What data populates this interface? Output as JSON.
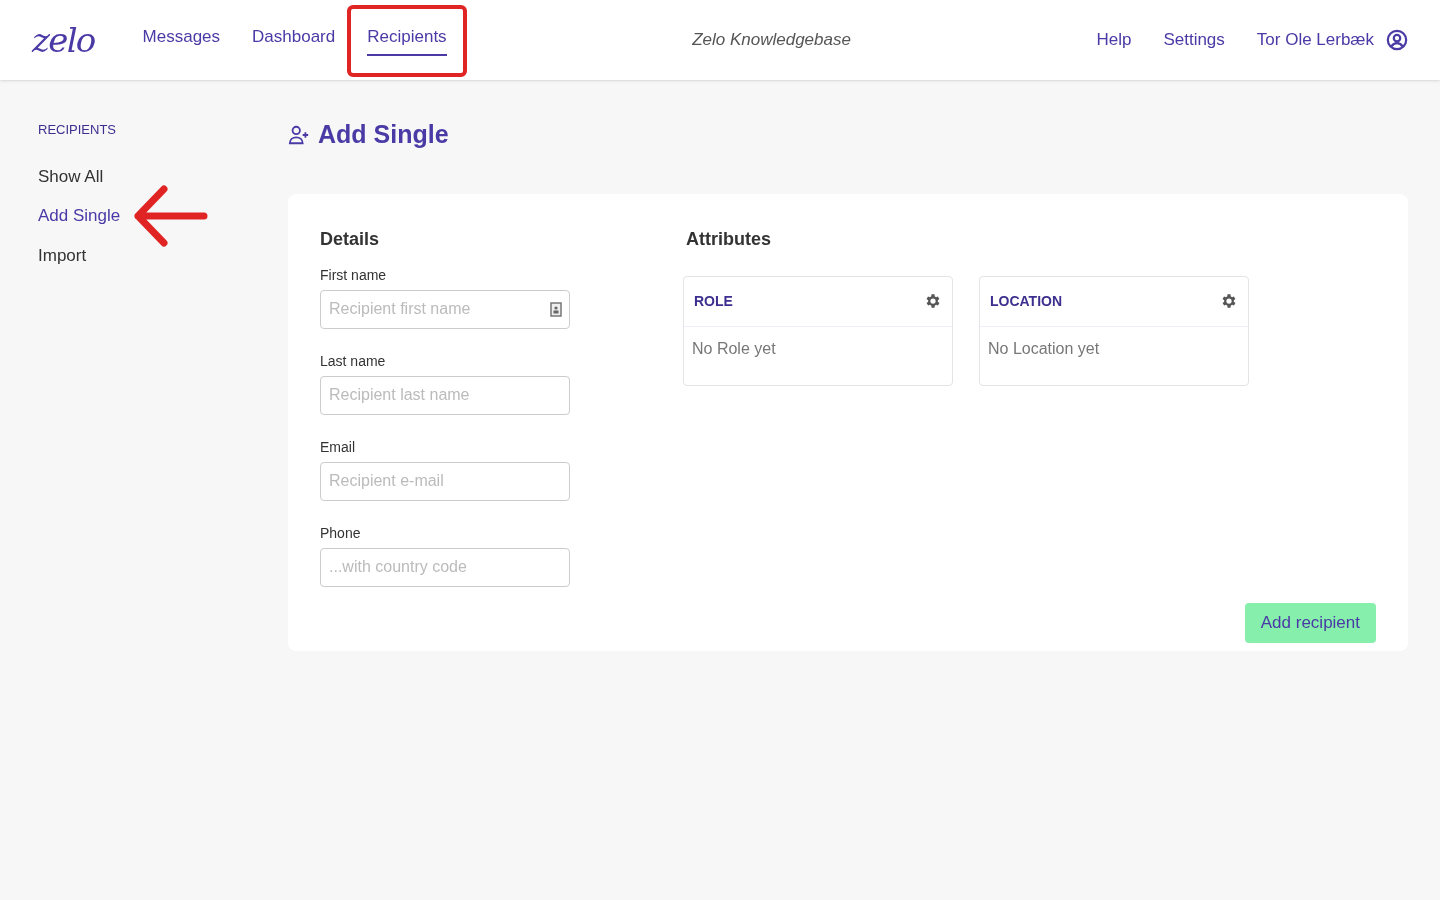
{
  "header": {
    "logo": "zelo",
    "nav": [
      {
        "label": "Messages",
        "selected": false
      },
      {
        "label": "Dashboard",
        "selected": false
      },
      {
        "label": "Recipients",
        "selected": true,
        "highlighted": true
      }
    ],
    "center_link": "Zelo Knowledgebase",
    "right": [
      {
        "label": "Help"
      },
      {
        "label": "Settings"
      }
    ],
    "user": "Tor Ole Lerbæk"
  },
  "sidebar": {
    "heading": "RECIPIENTS",
    "items": [
      {
        "label": "Show All",
        "selected": false,
        "pointed": false
      },
      {
        "label": "Add Single",
        "selected": true,
        "pointed": true
      },
      {
        "label": "Import",
        "selected": false,
        "pointed": false
      }
    ]
  },
  "page": {
    "title": "Add Single"
  },
  "details": {
    "heading": "Details",
    "fields": [
      {
        "label": "First name",
        "placeholder": "Recipient first name",
        "contact_icon": true
      },
      {
        "label": "Last name",
        "placeholder": "Recipient last name",
        "contact_icon": false
      },
      {
        "label": "Email",
        "placeholder": "Recipient e-mail",
        "contact_icon": false
      },
      {
        "label": "Phone",
        "placeholder": "...with country code",
        "contact_icon": false
      }
    ]
  },
  "attributes": {
    "heading": "Attributes",
    "cards": [
      {
        "title": "ROLE",
        "empty": "No Role yet"
      },
      {
        "title": "LOCATION",
        "empty": "No Location yet"
      }
    ]
  },
  "submit": "Add recipient"
}
